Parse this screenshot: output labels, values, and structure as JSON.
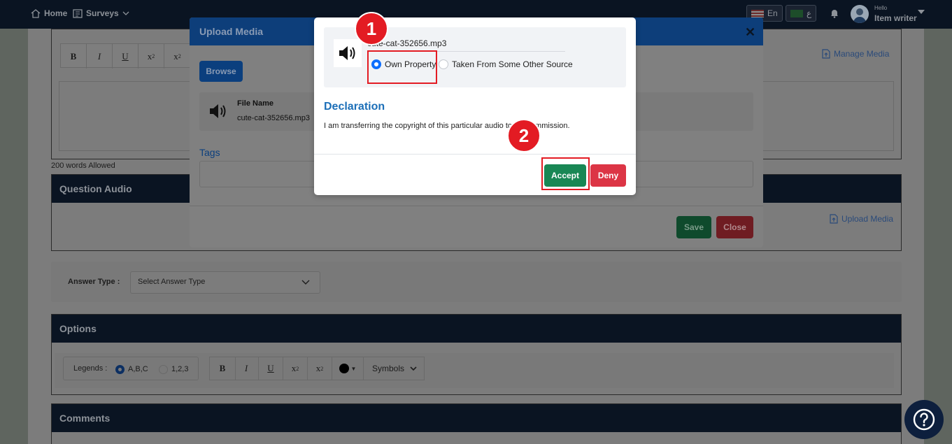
{
  "topbar": {
    "home": "Home",
    "surveys": "Surveys",
    "lang_en": "En",
    "lang_ar": "ع",
    "hello": "Hello",
    "user": "Item writer"
  },
  "editor": {
    "bold": "B",
    "italic": "I",
    "underline": "U",
    "subscript": "x",
    "sub_mark": "2",
    "superscript": "x",
    "sup_mark": "2",
    "manage_media": "Manage Media",
    "words_allowed": "200 words Allowed"
  },
  "question_audio": {
    "title": "Question Audio",
    "upload_media": "Upload Media"
  },
  "answer_type": {
    "label": "Answer Type :",
    "placeholder": "Select Answer Type"
  },
  "options": {
    "title": "Options",
    "legends_label": "Legends :",
    "legend_abc": "A,B,C",
    "legend_123": "1,2,3",
    "symbols": "Symbols"
  },
  "comments": {
    "title": "Comments"
  },
  "upload_modal": {
    "title": "Upload Media",
    "browse": "Browse",
    "file_name_label": "File Name",
    "file_name": "cute-cat-352656.mp3",
    "tags_label": "Tags",
    "save": "Save",
    "close": "Close"
  },
  "declaration_modal": {
    "file_name": "cute-cat-352656.mp3",
    "own_property": "Own Property",
    "other_source": "Taken From Some Other Source",
    "title": "Declaration",
    "text": "I am transferring the copyright of this particular audio to the commission.",
    "accept": "Accept",
    "deny": "Deny"
  },
  "annotations": {
    "step1": "1",
    "step2": "2",
    "highlight_color": "#e31b23"
  },
  "colors": {
    "navy": "#0a1422",
    "primary": "#0d6efd",
    "accept": "#198754",
    "deny": "#dc3545",
    "declaration_title": "#1c6fb8"
  }
}
